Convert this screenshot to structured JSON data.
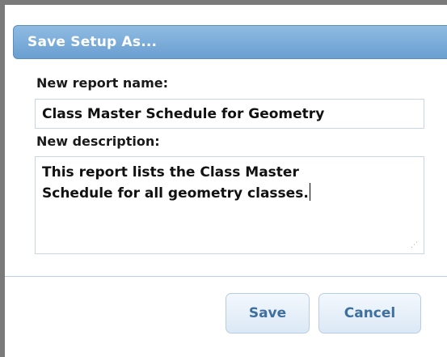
{
  "dialog": {
    "title": "Save Setup As...",
    "name_label": "New report name:",
    "name_value": "Class Master Schedule for Geometry",
    "description_label": "New description:",
    "description_line1": "This report lists the Class Master",
    "description_line2": "Schedule for all geometry classes.",
    "save_label": "Save",
    "cancel_label": "Cancel"
  },
  "colors": {
    "titlebar": "#7aaad8",
    "button_text": "#3f6f9f"
  }
}
